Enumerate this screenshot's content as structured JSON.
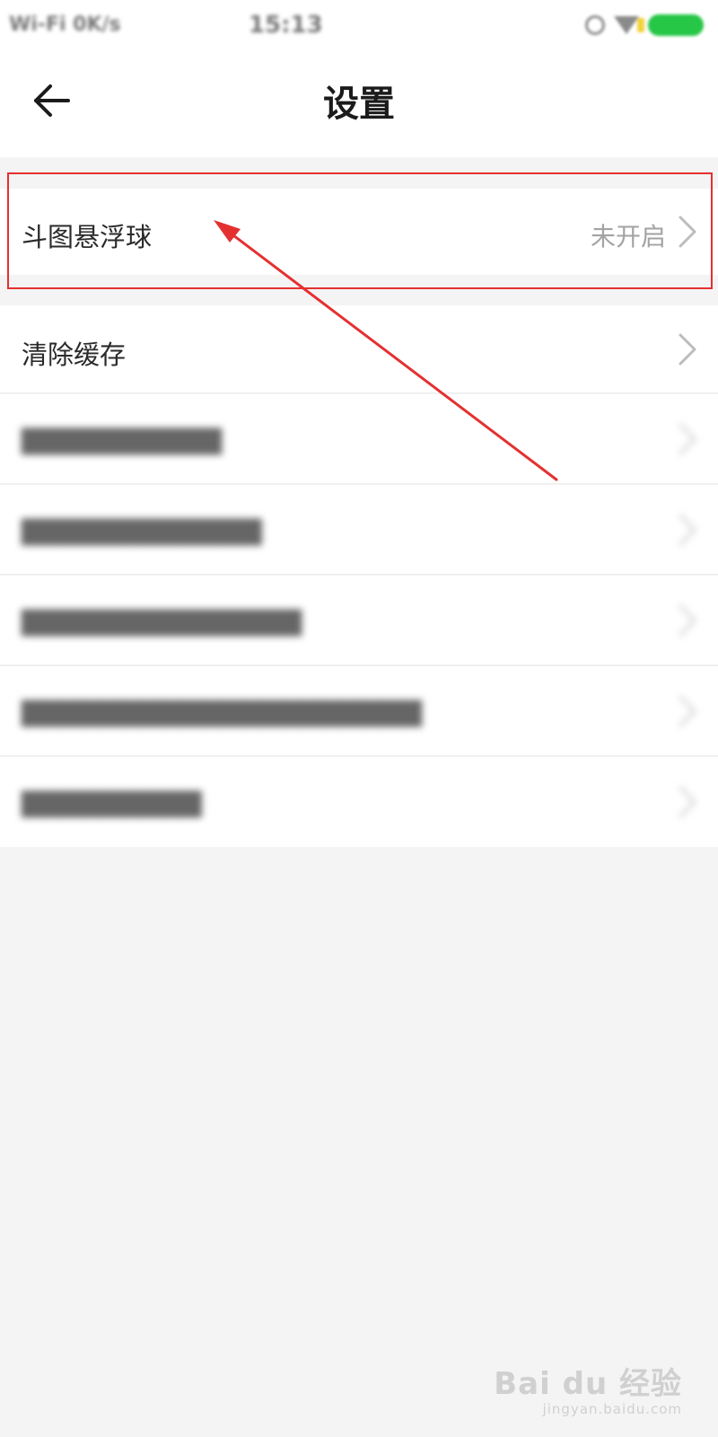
{
  "status_bar": {
    "left_text": "Wi-Fi 0K/s",
    "time": "15:13"
  },
  "header": {
    "title": "设置",
    "back_icon": "arrow-left-icon"
  },
  "settings": {
    "floating_ball": {
      "label": "斗图悬浮球",
      "value": "未开启"
    },
    "clear_cache": {
      "label": "清除缓存"
    }
  },
  "watermark": {
    "brand": "Bai du 经验",
    "site": "jingyan.baidu.com"
  },
  "colors": {
    "annotation_red": "#e53030",
    "background": "#f4f4f4",
    "battery_green": "#26c646"
  }
}
